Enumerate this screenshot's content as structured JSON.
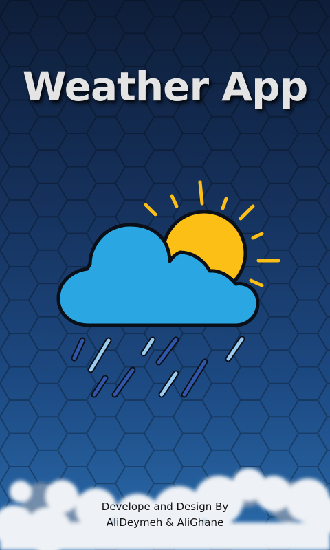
{
  "app": {
    "title": "Weather App"
  },
  "icon": {
    "name": "partly-cloudy-rain-icon"
  },
  "credits": {
    "line1": "Develope and Design By",
    "line2": "AliDeymeh & AliGhane"
  },
  "colors": {
    "background_top": "#0e1e39",
    "background_bottom": "#2a6cac",
    "sun": "#fcbf15",
    "cloud": "#2aa7e2",
    "rain_light": "#9ccdf0",
    "rain_dark": "#2f56a8",
    "title": "#e4e4e4"
  }
}
